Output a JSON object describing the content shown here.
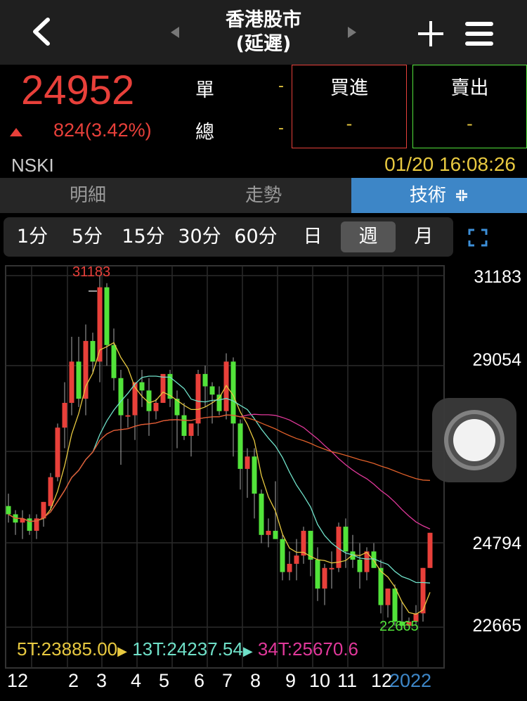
{
  "header": {
    "title_line1": "香港股市",
    "title_line2": "(延遲)",
    "icons": {
      "back": "back-chevron-icon",
      "prev": "prev-triangle-icon",
      "next": "next-triangle-icon",
      "add": "plus-icon",
      "menu": "hamburger-menu-icon"
    }
  },
  "quote": {
    "price": "24952",
    "change": "824(3.42%)",
    "direction": "up",
    "single_label": "單",
    "single_value": "-",
    "total_label": "總",
    "total_value": "-",
    "buy_label": "買進",
    "buy_value": "-",
    "sell_label": "賣出",
    "sell_value": "-",
    "symbol": "NSKI",
    "timestamp": "01/20 16:08:26",
    "colors": {
      "up": "#e8403a",
      "down": "#52e33a",
      "highlight": "#e8c940"
    }
  },
  "tabs": [
    {
      "label": "明細",
      "active": false
    },
    {
      "label": "走勢",
      "active": false
    },
    {
      "label": "技術",
      "active": true,
      "icon": "collapse-arrows-icon"
    }
  ],
  "periods": [
    {
      "label": "1分",
      "active": false
    },
    {
      "label": "5分",
      "active": false
    },
    {
      "label": "15分",
      "active": false
    },
    {
      "label": "30分",
      "active": false
    },
    {
      "label": "60分",
      "active": false
    },
    {
      "label": "日",
      "active": false
    },
    {
      "label": "週",
      "active": true
    },
    {
      "label": "月",
      "active": false
    }
  ],
  "fullscreen_icon": "fullscreen-icon",
  "chart_data": {
    "type": "candlestick",
    "y_ticks": [
      "31183",
      "29054",
      "24794",
      "22665"
    ],
    "ylim": [
      22665,
      31183
    ],
    "high_label": "31183",
    "low_label": "22665",
    "x_labels": [
      "12",
      "2",
      "3",
      "4",
      "5",
      "6",
      "7",
      "8",
      "9",
      "10",
      "11",
      "12",
      "2022"
    ],
    "ma_legend": [
      {
        "text": "5T:23885.00",
        "color": "#e8c940"
      },
      {
        "text": "13T:24237.54",
        "color": "#6fe0c8"
      },
      {
        "text": "34T:25670.6",
        "color": "#e0389a"
      }
    ],
    "ma_colors": {
      "ma5": "#e8c940",
      "ma13": "#6fe0c8",
      "ma34": "#e0389a",
      "ma_long": "#e0602a"
    },
    "candles": [
      [
        25600,
        25900,
        25200,
        25400
      ],
      [
        25400,
        25500,
        24900,
        25200
      ],
      [
        25200,
        25500,
        24800,
        25300
      ],
      [
        25300,
        25400,
        24900,
        25000
      ],
      [
        25000,
        25400,
        24800,
        25300
      ],
      [
        25300,
        25700,
        25100,
        25700
      ],
      [
        25600,
        26400,
        25500,
        26300
      ],
      [
        26300,
        27600,
        26200,
        27500
      ],
      [
        27500,
        28600,
        27000,
        28100
      ],
      [
        28100,
        29700,
        27800,
        29100
      ],
      [
        29100,
        29700,
        28000,
        28200
      ],
      [
        28200,
        30000,
        27800,
        29600
      ],
      [
        29600,
        29800,
        28800,
        29100
      ],
      [
        29100,
        31183,
        28600,
        30900
      ],
      [
        30900,
        31000,
        29000,
        29500
      ],
      [
        29500,
        29900,
        28400,
        28700
      ],
      [
        28700,
        28900,
        26600,
        27800
      ],
      [
        27800,
        28200,
        27500,
        27800
      ],
      [
        27800,
        28500,
        27200,
        28600
      ],
      [
        28600,
        28900,
        28000,
        28400
      ],
      [
        28400,
        28700,
        27300,
        27900
      ],
      [
        27900,
        28200,
        27700,
        28100
      ],
      [
        28100,
        28700,
        28100,
        28800
      ],
      [
        28800,
        28900,
        28000,
        28200
      ],
      [
        28200,
        28400,
        27000,
        27800
      ],
      [
        27800,
        28100,
        27200,
        27300
      ],
      [
        27300,
        27500,
        26800,
        27600
      ],
      [
        27600,
        28900,
        27300,
        28800
      ],
      [
        28800,
        29000,
        28000,
        28500
      ],
      [
        28500,
        28600,
        27600,
        28300
      ],
      [
        28300,
        28500,
        27800,
        27900
      ],
      [
        27900,
        29300,
        27700,
        29100
      ],
      [
        29100,
        29200,
        26800,
        27600
      ],
      [
        27600,
        27700,
        26000,
        26500
      ],
      [
        26500,
        27000,
        25800,
        26800
      ],
      [
        26800,
        27000,
        25300,
        25900
      ],
      [
        25900,
        26000,
        24700,
        24900
      ],
      [
        24900,
        25300,
        24600,
        25000
      ],
      [
        25000,
        26200,
        24800,
        24800
      ],
      [
        24800,
        24900,
        23800,
        24000
      ],
      [
        24000,
        24500,
        23800,
        24200
      ],
      [
        24200,
        24800,
        23800,
        24400
      ],
      [
        24400,
        25100,
        24200,
        25000
      ],
      [
        25000,
        25000,
        23900,
        24300
      ],
      [
        24300,
        24600,
        23300,
        23600
      ],
      [
        23600,
        24200,
        23200,
        24100
      ],
      [
        24100,
        24500,
        23600,
        24100
      ],
      [
        24100,
        25200,
        24000,
        25100
      ],
      [
        25100,
        25300,
        24100,
        24500
      ],
      [
        24500,
        24900,
        24100,
        24300
      ],
      [
        24300,
        24700,
        23600,
        24000
      ],
      [
        24000,
        24600,
        23800,
        24500
      ],
      [
        24500,
        24700,
        24100,
        24100
      ],
      [
        24100,
        24300,
        23000,
        23200
      ],
      [
        23200,
        23600,
        22900,
        23600
      ],
      [
        23600,
        23700,
        22700,
        22800
      ],
      [
        22800,
        23300,
        22600,
        22700
      ],
      [
        22700,
        22900,
        22700,
        22800
      ],
      [
        22800,
        23200,
        22700,
        23000
      ],
      [
        23000,
        24100,
        22800,
        24100
      ],
      [
        24100,
        24952,
        24100,
        24952
      ]
    ]
  }
}
